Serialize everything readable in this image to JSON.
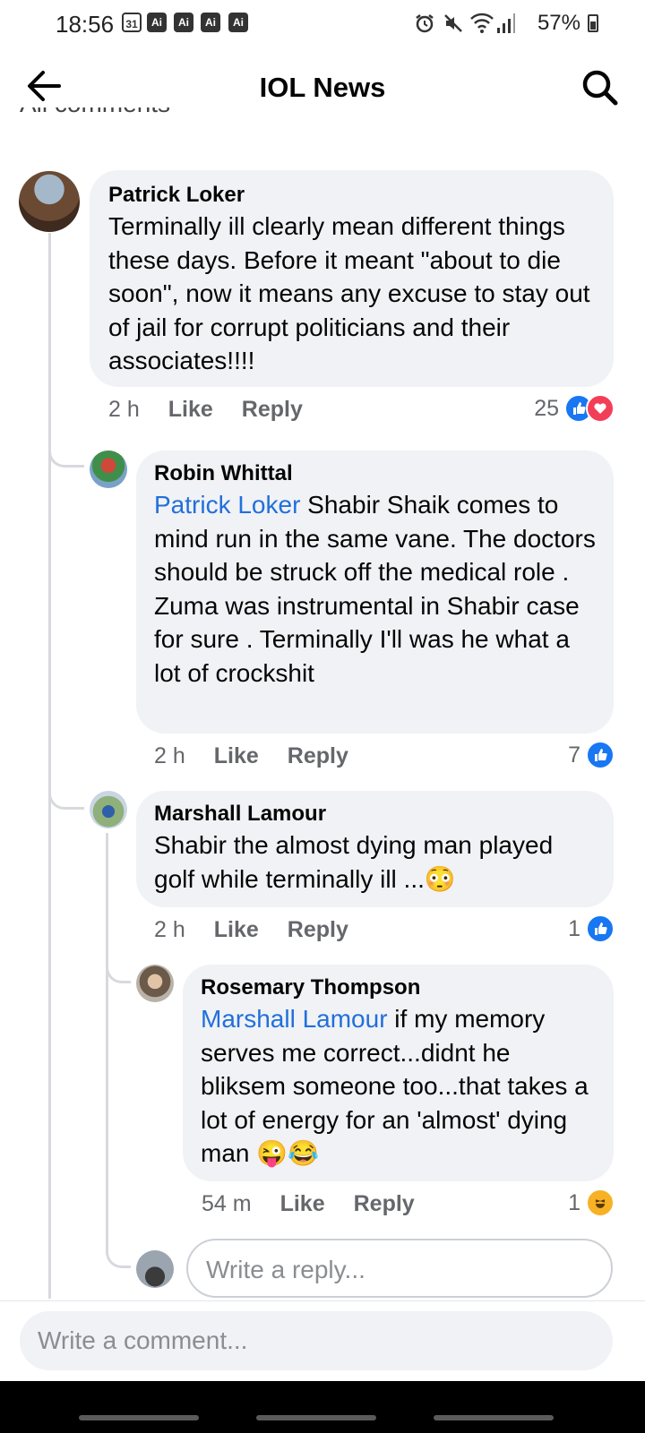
{
  "status_bar": {
    "time": "18:56",
    "calendar_day": "31",
    "ai_badges": [
      "Ai",
      "Ai",
      "Ai",
      "Ai"
    ],
    "battery": "57%"
  },
  "header": {
    "title": "IOL News"
  },
  "section_heading": "All comments",
  "comments": [
    {
      "author": "Patrick Loker",
      "mention": "",
      "text": "Terminally ill clearly mean different things these days. Before it meant \"about to die soon\", now it means any excuse to stay out of jail for corrupt politicians and their associates!!!!",
      "age": "2 h",
      "like_label": "Like",
      "reply_label": "Reply",
      "reaction_count": "25",
      "reactions": [
        "like",
        "love"
      ]
    },
    {
      "author": "Robin Whittal",
      "mention": "Patrick Loker",
      "text": " Shabir Shaik comes to mind run in the same vane.  The doctors should be struck off the medical role . Zuma was instrumental in Shabir case for sure . Terminally I'll was he what a lot of crockshit",
      "age": "2 h",
      "like_label": "Like",
      "reply_label": "Reply",
      "reaction_count": "7",
      "reactions": [
        "like"
      ]
    },
    {
      "author": "Marshall Lamour",
      "mention": "",
      "text": "Shabir the almost dying man played golf while terminally ill ...",
      "emoji": "😳",
      "age": "2 h",
      "like_label": "Like",
      "reply_label": "Reply",
      "reaction_count": "1",
      "reactions": [
        "like"
      ]
    },
    {
      "author": "Rosemary Thompson",
      "mention": "Marshall Lamour",
      "text": " if my memory serves me correct...didnt he bliksem someone too...that takes a lot of energy for an 'almost' dying man ",
      "emoji": "😜😂",
      "age": "54 m",
      "like_label": "Like",
      "reply_label": "Reply",
      "reaction_count": "1",
      "reactions": [
        "haha"
      ]
    }
  ],
  "reply_input": {
    "placeholder": "Write a reply..."
  },
  "comment_input": {
    "placeholder": "Write a comment..."
  },
  "colors": {
    "bubble": "#f0f2f5",
    "mention": "#216fdb",
    "like": "#1877f2",
    "love": "#f33e58",
    "haha": "#f7b125"
  }
}
